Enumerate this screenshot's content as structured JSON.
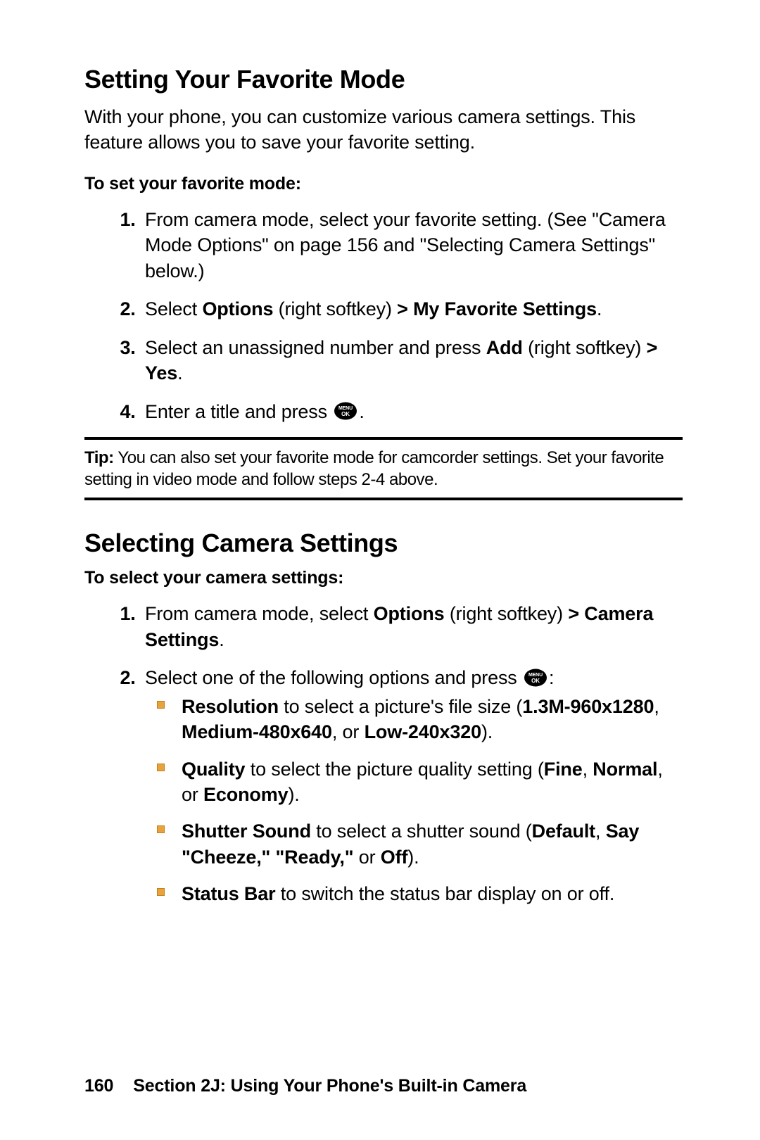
{
  "section1": {
    "heading": "Setting Your Favorite Mode",
    "intro": "With your phone, you can customize various camera settings. This feature allows you to save your favorite setting.",
    "subheading": "To set your favorite mode:",
    "step1": "From camera mode, select your favorite setting. (See \"Camera Mode Options\" on page 156 and \"Selecting Camera Settings\" below.)",
    "step2_a": "Select ",
    "step2_b": "Options",
    "step2_c": " (right softkey) ",
    "step2_d": "> My Favorite Settings",
    "step2_e": ".",
    "step3_a": "Select an unassigned number and press ",
    "step3_b": "Add",
    "step3_c": " (right softkey) ",
    "step3_d": "> Yes",
    "step3_e": ".",
    "step4_a": "Enter a title and press ",
    "step4_b": "."
  },
  "tip": {
    "label": "Tip:",
    "text": " You can also set your favorite mode for camcorder settings. Set your favorite setting in video mode and follow steps 2-4 above."
  },
  "section2": {
    "heading": "Selecting Camera Settings",
    "subheading": "To select your camera settings:",
    "step1_a": "From camera mode, select ",
    "step1_b": "Options",
    "step1_c": " (right softkey) ",
    "step1_d": "> Camera Settings",
    "step1_e": ".",
    "step2_a": "Select one of the following options and press ",
    "step2_b": ":",
    "bullets": {
      "res_a": "Resolution",
      "res_b": " to select a picture's file size (",
      "res_c": "1.3M-960x1280",
      "res_d": ", ",
      "res_e": "Medium-480x640",
      "res_f": ", or ",
      "res_g": "Low-240x320",
      "res_h": ").",
      "qual_a": "Quality",
      "qual_b": " to select the picture quality setting (",
      "qual_c": "Fine",
      "qual_d": ", ",
      "qual_e": "Normal",
      "qual_f": ", or ",
      "qual_g": "Economy",
      "qual_h": ").",
      "shut_a": "Shutter Sound",
      "shut_b": " to select a shutter sound (",
      "shut_c": "Default",
      "shut_d": ", ",
      "shut_e": "Say \"Cheeze,\" \"Ready,\"",
      "shut_f": " or ",
      "shut_g": "Off",
      "shut_h": ").",
      "stat_a": "Status Bar",
      "stat_b": " to switch the status bar display on or off."
    }
  },
  "footer": {
    "page": "160",
    "text": "Section 2J: Using Your Phone's Built-in Camera"
  },
  "icon": {
    "menu": "MENU",
    "ok": "OK"
  }
}
